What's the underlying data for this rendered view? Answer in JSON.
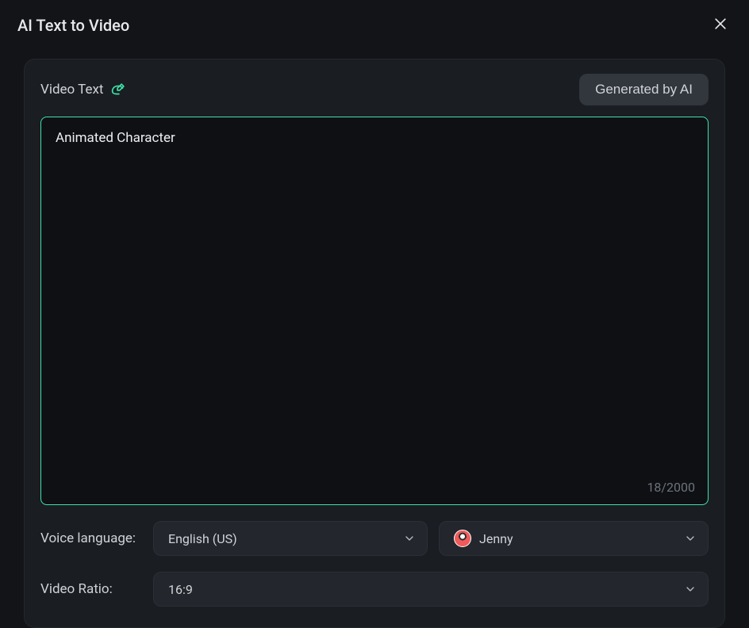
{
  "header": {
    "title": "AI Text to Video"
  },
  "panel": {
    "video_text_label": "Video Text",
    "generated_by_ai_label": "Generated by AI",
    "textarea_value": "Animated Character",
    "char_count": "18/2000",
    "voice_language_label": "Voice language:",
    "voice_language_value": "English (US)",
    "voice_name": "Jenny",
    "video_ratio_label": "Video Ratio:",
    "video_ratio_value": "16:9"
  }
}
